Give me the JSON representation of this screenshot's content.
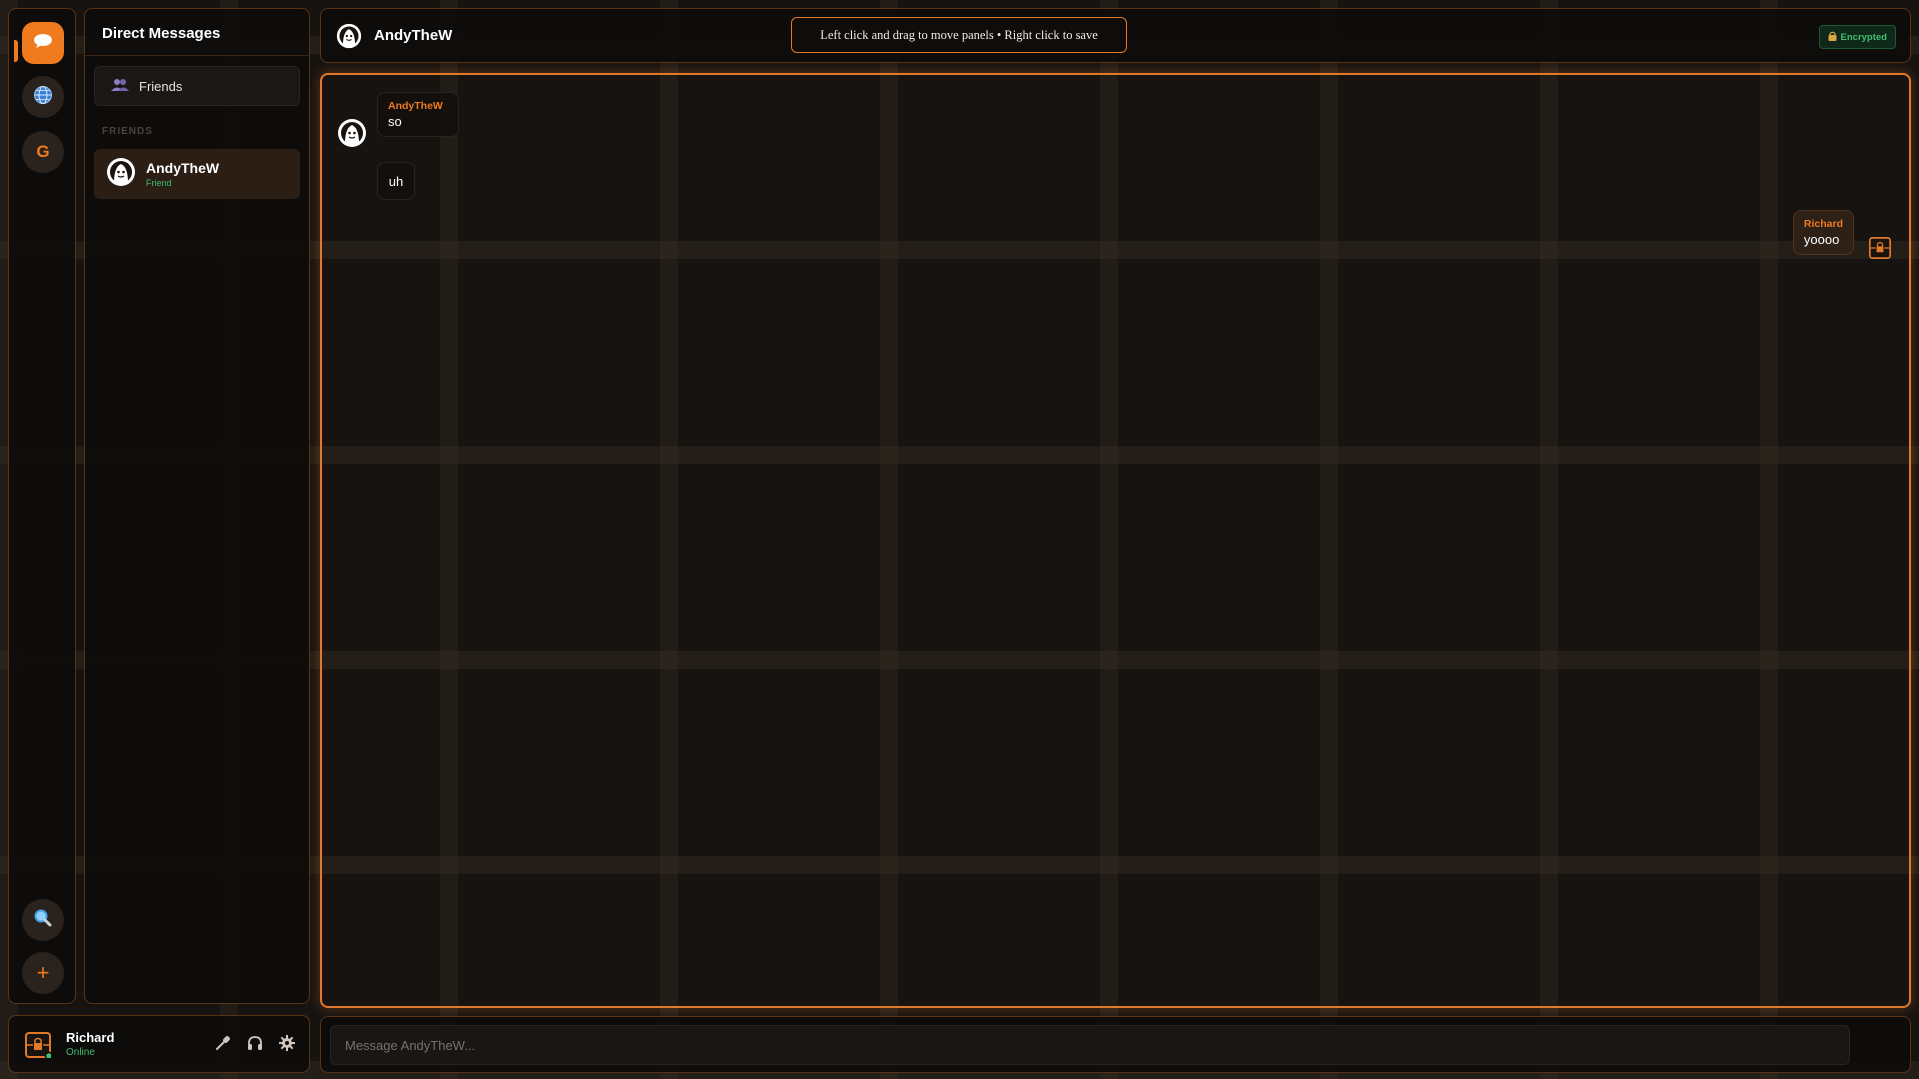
{
  "rail": {
    "items": [
      {
        "name": "home",
        "icon": "chat-bubble-icon",
        "active": true
      },
      {
        "name": "explore",
        "icon": "globe-icon"
      },
      {
        "name": "server",
        "letter": "G"
      },
      {
        "name": "search",
        "icon": "search-icon"
      },
      {
        "name": "add-server",
        "icon": "plus-icon",
        "glyph": "+"
      }
    ]
  },
  "sidebar": {
    "title": "Direct Messages",
    "friends_button": "Friends",
    "section_label": "FRIENDS",
    "friends": [
      {
        "name": "AndyTheW",
        "status": "Friend"
      }
    ]
  },
  "user_bar": {
    "name": "Richard",
    "status": "Online"
  },
  "header": {
    "title": "AndyTheW",
    "hint": "Left click and drag to move panels • Right click to save",
    "encrypted_label": "Encrypted"
  },
  "messages": [
    {
      "author": "AndyTheW",
      "text": "so"
    },
    {
      "author": "AndyTheW",
      "text": "uh"
    },
    {
      "author": "Richard",
      "text": "yoooo"
    }
  ],
  "composer": {
    "placeholder": "Message AndyTheW..."
  },
  "colors": {
    "accent": "#f07a1e",
    "online": "#3fbf6f",
    "encrypted_bg": "#10281a"
  }
}
